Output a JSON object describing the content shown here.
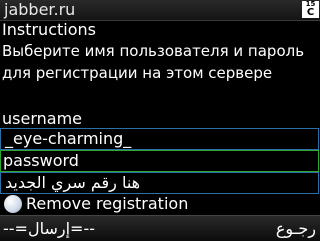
{
  "titlebar": {
    "title": "jabber.ru",
    "kb_top": "15",
    "kb_bottom": "C"
  },
  "form": {
    "heading": "Instructions",
    "instructions": "Выберите имя пользователя и пароль для регистрации на этом сервере",
    "username_label": "username",
    "username_value": "_eye-charming_",
    "password_label": "password",
    "password_value": "هنا رقم سري الجديد",
    "remove_label": "Remove registration"
  },
  "softkeys": {
    "left": "--=إرسال=--",
    "right": "رجـوع"
  },
  "colors": {
    "field_border": "#2f6fa8",
    "password_border": "#2fa82f",
    "background": "#000000"
  }
}
